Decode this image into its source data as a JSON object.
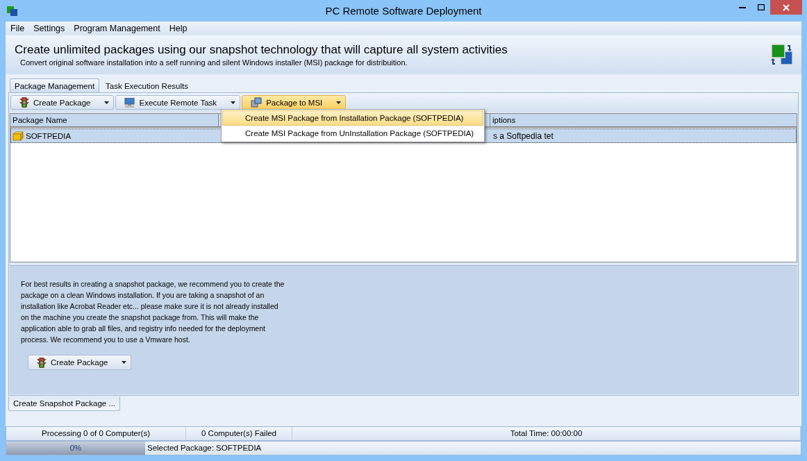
{
  "window": {
    "title": "PC Remote Software Deployment"
  },
  "menu": [
    "File",
    "Settings",
    "Program Management",
    "Help"
  ],
  "header": {
    "title": "Create unlimited packages using our snapshot technology that will capture all system activities",
    "subtitle": "Convert original software installation into a self running and silent Windows installer (MSI) package for distribuition."
  },
  "tabs": [
    {
      "label": "Package Management",
      "selected": true
    },
    {
      "label": "Task Execution Results",
      "selected": false
    }
  ],
  "toolbar": [
    {
      "label": "Create Package",
      "kind": "traffic",
      "selected": false
    },
    {
      "label": "Execute Remote Task",
      "kind": "computer",
      "selected": false
    },
    {
      "label": "Package to MSI",
      "kind": "package",
      "selected": true
    }
  ],
  "dropdown": [
    {
      "label": "Create MSI Package from Installation Package (SOFTPEDIA)",
      "selected": true
    },
    {
      "label": "Create MSI Package from UnInstallation Package (SOFTPEDIA)",
      "selected": false
    }
  ],
  "table": {
    "columns": [
      "Package Name",
      "iptions"
    ],
    "rows": [
      {
        "name": "SOFTPEDIA",
        "column_3": "s a Softpedia tet",
        "selected": true
      }
    ]
  },
  "info": {
    "text": "For best results in creating a snapshot package, we recommend you to create the package on a clean Windows installation. If you are taking a snapshot of an installation like Acrobat Reader etc... please make sure it is not already installed on the machine you create the snapshot package from. This will make the application able to grab all files, and registry info needed for the deployment process. We recommend you to use a Vmware host.",
    "button": "Create Package"
  },
  "bottom_tab": "Create Snapshot Package ...",
  "status_bar": {
    "processing": "Processing 0 of 0 Computer(s)",
    "failed": "0 Computer(s) Failed",
    "total_time": "Total Time: 00:00:00",
    "progress": "0%",
    "level": 0,
    "selected_package": "Selected Package: SOFTPEDIA"
  }
}
